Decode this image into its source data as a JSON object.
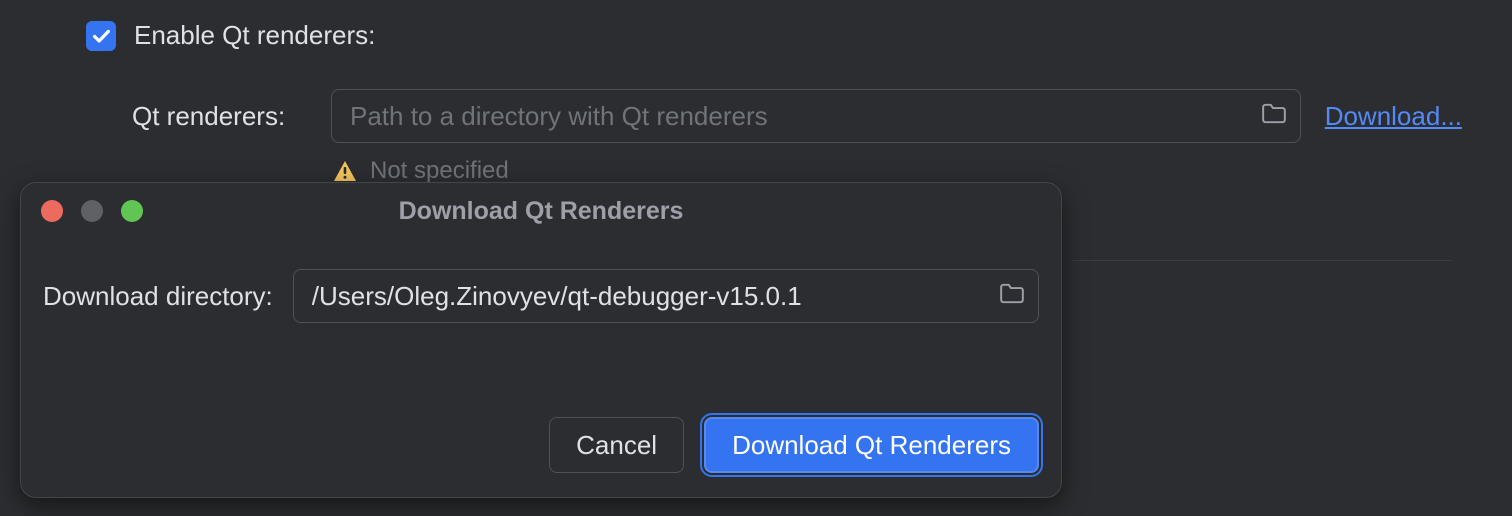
{
  "settings": {
    "enable_checkbox_label": "Enable Qt renderers:",
    "renderers_label": "Qt renderers:",
    "renderers_placeholder": "Path to a directory with Qt renderers",
    "download_link": "Download...",
    "warning_text": "Not specified"
  },
  "dialog": {
    "title": "Download Qt Renderers",
    "download_dir_label": "Download directory:",
    "download_dir_value": "/Users/Oleg.Zinovyev/qt-debugger-v15.0.1",
    "cancel_label": "Cancel",
    "download_button_label": "Download Qt Renderers"
  }
}
